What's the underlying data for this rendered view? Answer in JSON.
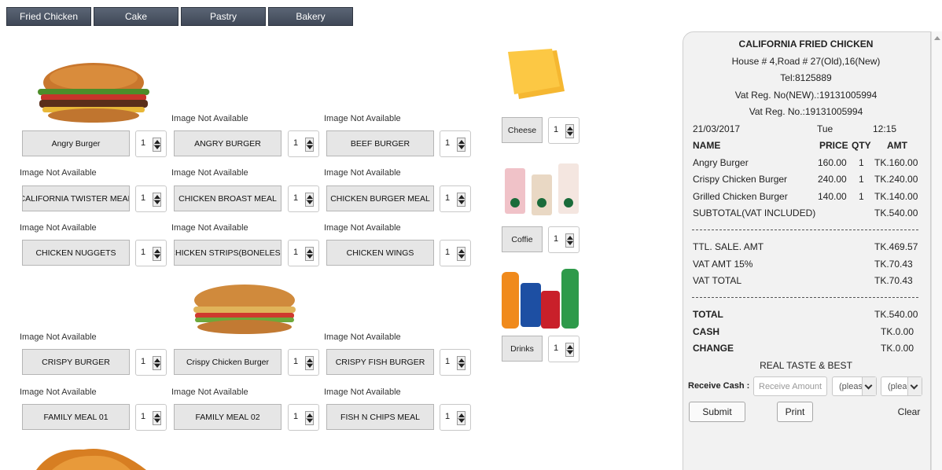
{
  "tabs": [
    "Fried Chicken",
    "Cake",
    "Pastry",
    "Bakery"
  ],
  "img_na": "Image Not Available",
  "products": [
    "Angry Burger",
    "ANGRY BURGER",
    "BEEF BURGER",
    "CALIFORNIA TWISTER MEAL",
    "CHICKEN BROAST MEAL",
    "CHICKEN BURGER MEAL",
    "CHICKEN NUGGETS",
    "CHICKEN STRIPS(BONELESS",
    "CHICKEN WINGS",
    "CRISPY BURGER",
    "Crispy Chicken Burger",
    "CRISPY FISH BURGER",
    "FAMILY MEAL 01",
    "FAMILY MEAL 02",
    "FISH N CHIPS MEAL"
  ],
  "qty": "1",
  "side_items": [
    "Cheese",
    "Coffie",
    "Drinks"
  ],
  "receipt": {
    "shop": "CALIFORNIA  FRIED  CHICKEN",
    "address": "House # 4,Road # 27(Old),16(New)",
    "tel": "Tel:8125889",
    "vat_new": "Vat Reg. No(NEW).:19131005994",
    "vat": "Vat Reg. No.:19131005994",
    "date": "21/03/2017",
    "day": "Tue",
    "time": "12:15",
    "head": {
      "name": "NAME",
      "price": "PRICE",
      "qty": "QTY",
      "amt": "AMT"
    },
    "items": [
      {
        "name": "Angry Burger",
        "price": "160.00",
        "qty": "1",
        "amt": "TK.160.00"
      },
      {
        "name": "Crispy Chicken Burger",
        "price": "240.00",
        "qty": "1",
        "amt": "TK.240.00"
      },
      {
        "name": "Grilled Chicken Burger",
        "price": "140.00",
        "qty": "1",
        "amt": "TK.140.00"
      }
    ],
    "subtotal_label": "SUBTOTAL(VAT INCLUDED)",
    "subtotal": "TK.540.00",
    "ttl_sale_label": "TTL. SALE. AMT",
    "ttl_sale": "TK.469.57",
    "vat_amt_label": "VAT AMT 15%",
    "vat_amt": "TK.70.43",
    "vat_total_label": "VAT TOTAL",
    "vat_total": "TK.70.43",
    "total_label": "TOTAL",
    "total": "TK.540.00",
    "cash_label": "CASH",
    "cash": "TK.0.00",
    "change_label": "CHANGE",
    "change": "TK.0.00",
    "slogan": "REAL TASTE & BEST",
    "receive_label": "Receive Cash :",
    "receive_placeholder": "Receive Amount",
    "select1": "(pleas",
    "select2": "(plea",
    "submit": "Submit",
    "print": "Print",
    "clear": "Clear"
  }
}
